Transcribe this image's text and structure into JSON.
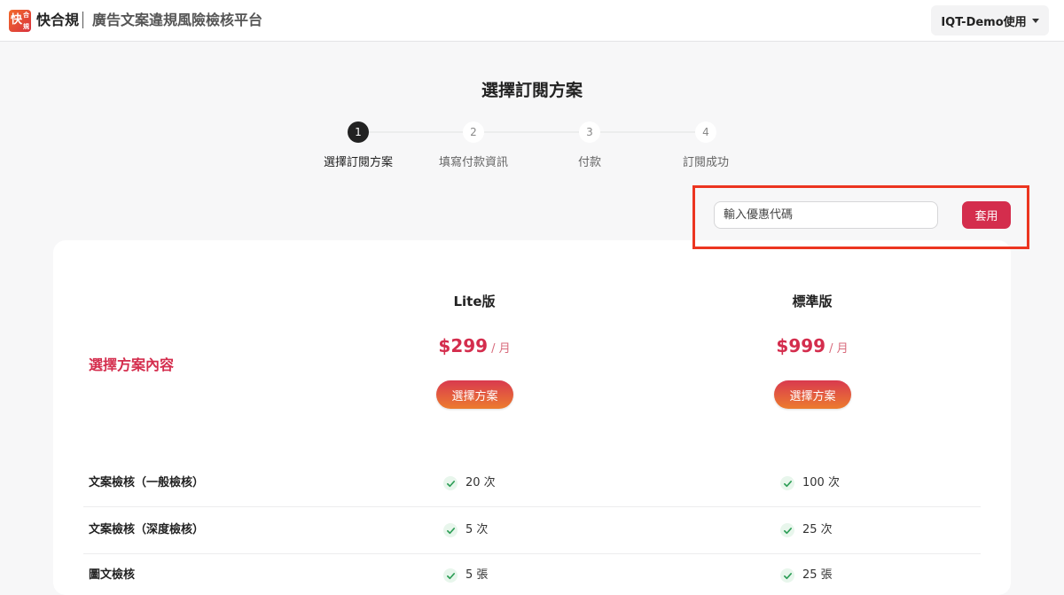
{
  "header": {
    "logo": {
      "char_main": "快",
      "char_top": "合",
      "char_bottom": "規"
    },
    "brand": "快合規",
    "subtitle": "廣告文案違規風險檢核平台",
    "user_menu": "IQT-Demo使用"
  },
  "page": {
    "title": "選擇訂閱方案"
  },
  "steps": [
    {
      "number": "1",
      "label": "選擇訂閱方案",
      "active": true
    },
    {
      "number": "2",
      "label": "填寫付款資訊",
      "active": false
    },
    {
      "number": "3",
      "label": "付款",
      "active": false
    },
    {
      "number": "4",
      "label": "訂閱成功",
      "active": false
    }
  ],
  "coupon": {
    "placeholder": "輸入優惠代碼",
    "apply_label": "套用",
    "highlight_color": "#ec3520"
  },
  "plans": {
    "section_label": "選擇方案內容",
    "items": [
      {
        "name": "Lite版",
        "price": "$299",
        "period": "/ 月",
        "button": "選擇方案"
      },
      {
        "name": "標準版",
        "price": "$999",
        "period": "/ 月",
        "button": "選擇方案"
      }
    ]
  },
  "features": [
    {
      "label": "文案檢核（一般檢核）",
      "values": [
        "20 次",
        "100 次"
      ]
    },
    {
      "label": "文案檢核（深度檢核）",
      "values": [
        "5 次",
        "25 次"
      ]
    },
    {
      "label": "圖文檢核",
      "values": [
        "5 張",
        "25 張"
      ]
    }
  ],
  "colors": {
    "accent": "#d42d4d",
    "check": "#2e9e57"
  }
}
